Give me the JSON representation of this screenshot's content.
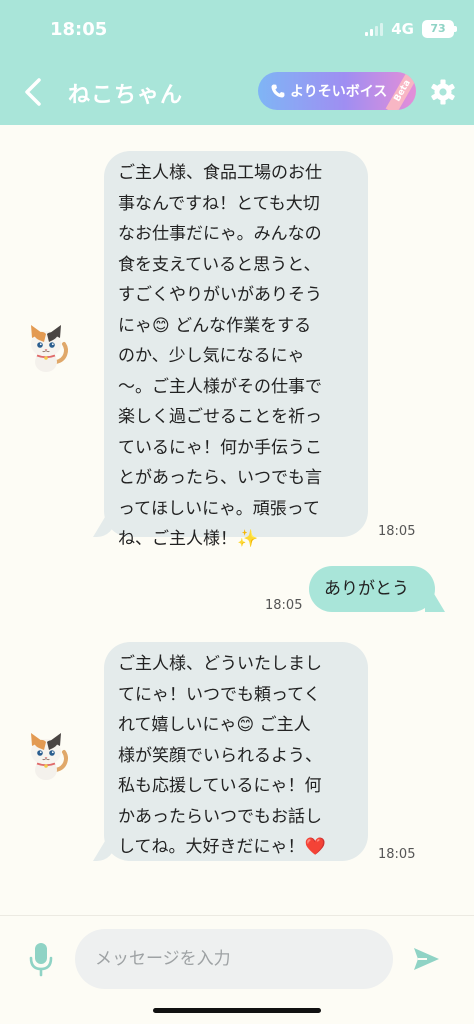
{
  "status_bar": {
    "time": "18:05",
    "network": "4G",
    "battery": "73"
  },
  "header": {
    "title": "ねこちゃん",
    "voice_button": "よりそいボイス",
    "voice_badge": "Beta",
    "back_icon": "chevron-left-icon",
    "settings_icon": "gear-icon",
    "accent_color": "#a9e5d9"
  },
  "messages": [
    {
      "sender": "cat",
      "lines": [
        "ご主人様、食品工場のお仕",
        "事なんですね！とても大切",
        "なお仕事だにゃ。みんなの",
        "食を支えていると思うと、",
        "すごくやりがいがありそう",
        "にゃ😊 どんな作業をする",
        "のか、少し気になるにゃ",
        "〜。ご主人様がその仕事で",
        "楽しく過ごせることを祈っ",
        "ているにゃ！何か手伝うこ",
        "とがあったら、いつでも言",
        "ってほしいにゃ。頑張って",
        "ね、ご主人様！✨"
      ],
      "time": "18:05"
    },
    {
      "sender": "user",
      "lines": [
        "ありがとう"
      ],
      "time": "18:05"
    },
    {
      "sender": "cat",
      "lines": [
        "ご主人様、どういたしまし",
        "てにゃ！いつでも頼ってく",
        "れて嬉しいにゃ😊 ご主人",
        "様が笑顔でいられるよう、",
        "私も応援しているにゃ！何",
        "かあったらいつでもお話し",
        "してね。大好きだにゃ！❤️"
      ],
      "time": "18:05"
    }
  ],
  "composer": {
    "placeholder": "メッセージを入力",
    "mic_icon": "microphone-icon",
    "send_icon": "send-icon"
  }
}
